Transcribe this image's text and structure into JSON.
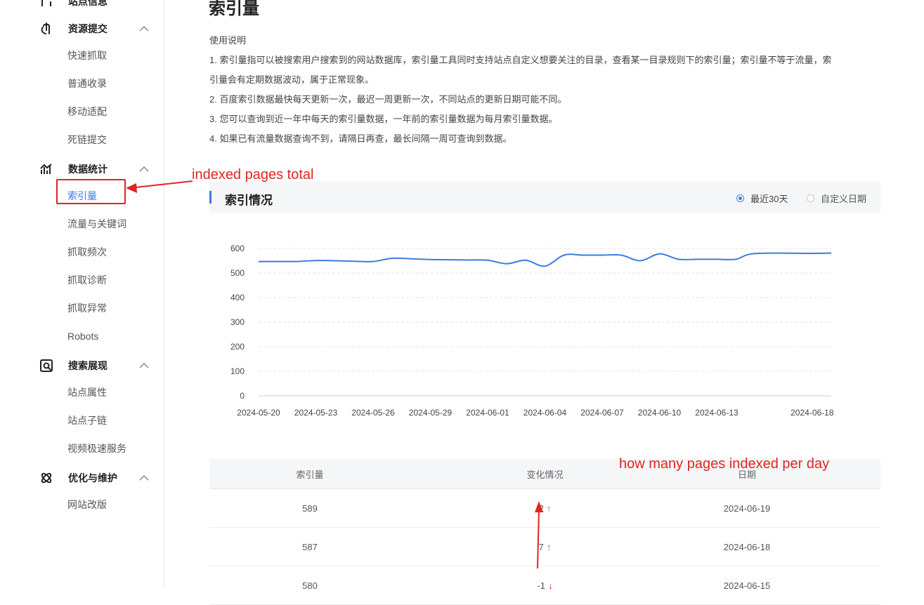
{
  "sidebar": {
    "top_item": "站点信息",
    "sections": [
      {
        "title": "资源提交",
        "icon": "resource-submit-icon",
        "items": [
          "快速抓取",
          "普通收录",
          "移动适配",
          "死链提交"
        ]
      },
      {
        "title": "数据统计",
        "icon": "data-stats-icon",
        "items": [
          "索引量",
          "流量与关键词",
          "抓取频次",
          "抓取诊断",
          "抓取异常",
          "Robots"
        ]
      },
      {
        "title": "搜索展现",
        "icon": "search-display-icon",
        "items": [
          "站点属性",
          "站点子链",
          "视频极速服务"
        ]
      },
      {
        "title": "优化与维护",
        "icon": "optimize-maintain-icon",
        "items": [
          "网站改版"
        ]
      }
    ],
    "active_item": "索引量"
  },
  "main": {
    "title": "索引量",
    "instructions": {
      "heading": "使用说明",
      "line1": "1. 索引量指可以被搜索用户搜索到的网站数据库，索引量工具同时支持站点自定义想要关注的目录，查看某一目录规则下的索引量；索引量不等于流量，索",
      "line1b": "引量会有定期数据波动，属于正常现象。",
      "line2": "2. 百度索引数据最快每天更新一次，最迟一周更新一次，不同站点的更新日期可能不同。",
      "line3": "3. 您可以查询到近一年中每天的索引量数据，一年前的索引量数据为每月索引量数据。",
      "line4": "4. 如果已有流量数据查询不到，请隔日再查，最长间隔一周可查询到数据。"
    },
    "panel": {
      "title": "索引情况",
      "radio_recent": "最近30天",
      "radio_custom": "自定义日期",
      "selected": "最近30天"
    },
    "table": {
      "headers": [
        "索引量",
        "变化情况",
        "日期"
      ],
      "rows": [
        {
          "count": "589",
          "change": "2",
          "direction": "up",
          "date": "2024-06-19"
        },
        {
          "count": "587",
          "change": "7",
          "direction": "up",
          "date": "2024-06-18"
        },
        {
          "count": "580",
          "change": "-1",
          "direction": "down",
          "date": "2024-06-15"
        }
      ]
    }
  },
  "annotations": {
    "sidebar_note": "indexed pages total",
    "table_note": "how many pages indexed per day",
    "color": "#e02424"
  },
  "colors": {
    "accent": "#3b7be0",
    "up": "#3aa34a",
    "down": "#e02424"
  },
  "chart_data": {
    "type": "line",
    "ylim": [
      0,
      600
    ],
    "yticks": [
      0,
      100,
      200,
      300,
      400,
      500,
      600
    ],
    "xticks": [
      "2024-05-20",
      "2024-05-23",
      "2024-05-26",
      "2024-05-29",
      "2024-06-01",
      "2024-06-04",
      "2024-06-07",
      "2024-06-10",
      "2024-06-13",
      "2024-06-18"
    ],
    "series": [
      {
        "color": "#3b7be0",
        "x": [
          "2024-05-20",
          "2024-05-21",
          "2024-05-22",
          "2024-05-23",
          "2024-05-24",
          "2024-05-25",
          "2024-05-26",
          "2024-05-27",
          "2024-05-28",
          "2024-05-29",
          "2024-05-30",
          "2024-05-31",
          "2024-06-01",
          "2024-06-02",
          "2024-06-03",
          "2024-06-04",
          "2024-06-05",
          "2024-06-06",
          "2024-06-07",
          "2024-06-08",
          "2024-06-09",
          "2024-06-10",
          "2024-06-11",
          "2024-06-12",
          "2024-06-13",
          "2024-06-14",
          "2024-06-15",
          "2024-06-18",
          "2024-06-19"
        ],
        "values": [
          547,
          547,
          547,
          551,
          550,
          548,
          547,
          560,
          558,
          555,
          554,
          553,
          552,
          538,
          552,
          528,
          573,
          573,
          573,
          573,
          550,
          578,
          556,
          556,
          556,
          556,
          579,
          580,
          581
        ]
      }
    ],
    "grid": true
  }
}
